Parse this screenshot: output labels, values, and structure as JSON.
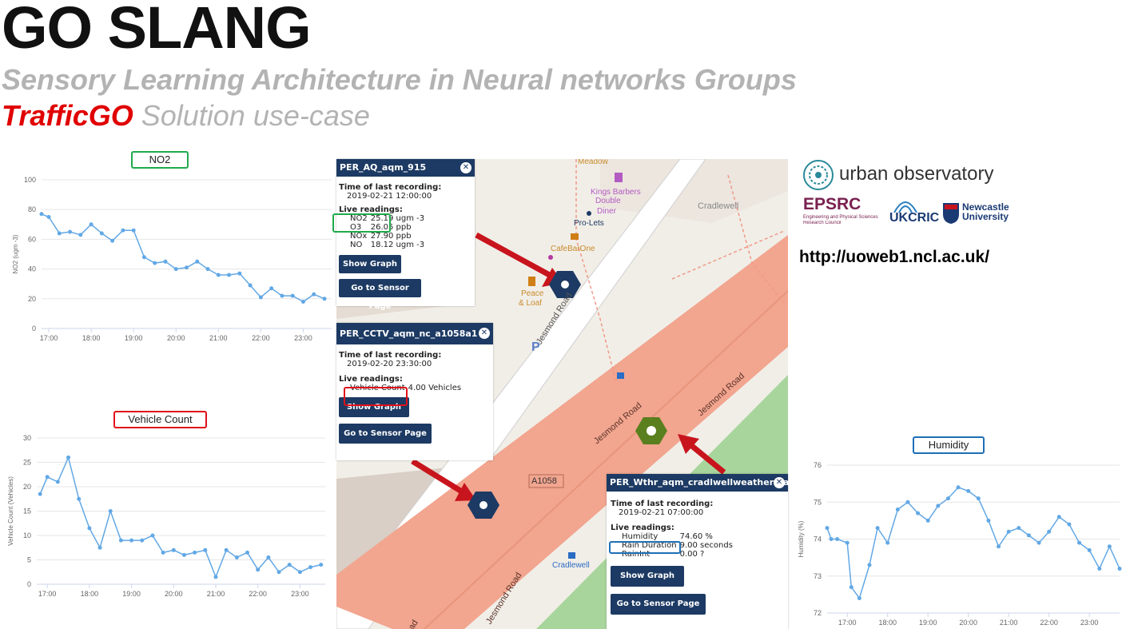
{
  "header": {
    "title": "GO SLANG",
    "subtitle": "Sensory Learning Architecture in Neural networks Groups",
    "usecase_brand": "TrafficGO",
    "usecase_rest": " Solution use-case"
  },
  "colors": {
    "brand_red": "#e00000",
    "no2_box": "#1faa4c",
    "vehicle_box": "#e0101a",
    "humidity_box": "#1e6fb5",
    "line": "#62a8e5",
    "popup_header": "#1c3a63",
    "road": "#f2a58f"
  },
  "charts": {
    "no2": {
      "title": "NO2",
      "ylabel": "NO2 (ugm -3)"
    },
    "vehicle": {
      "title": "Vehicle Count",
      "ylabel": "Vehicle Count (Vehicles)"
    },
    "humidity": {
      "title": "Humidity",
      "ylabel": "Humidity (%)"
    }
  },
  "chart_data": [
    {
      "type": "line",
      "title": "NO2",
      "ylabel": "NO2 (ugm -3)",
      "yticks": [
        0,
        20,
        40,
        60,
        80,
        100
      ],
      "ylim": [
        0,
        100
      ],
      "xticks": [
        "17:00",
        "18:00",
        "19:00",
        "20:00",
        "21:00",
        "22:00",
        "23:00"
      ],
      "xlim": [
        16.83,
        23.67
      ],
      "x": [
        16.83,
        17,
        17.25,
        17.5,
        17.75,
        18,
        18.25,
        18.5,
        18.75,
        19,
        19.25,
        19.5,
        19.75,
        20,
        20.25,
        20.5,
        20.75,
        21,
        21.25,
        21.5,
        21.75,
        22,
        22.25,
        22.5,
        22.75,
        23,
        23.25,
        23.5
      ],
      "series": [
        {
          "values": [
            77,
            75,
            64,
            65,
            63,
            70,
            64,
            59,
            66,
            66,
            48,
            44,
            45,
            40,
            41,
            45,
            40,
            36,
            36,
            37,
            29,
            21,
            27,
            22,
            22,
            18,
            23,
            20
          ]
        }
      ]
    },
    {
      "type": "line",
      "title": "Vehicle Count",
      "ylabel": "Vehicle Count (Vehicles)",
      "yticks": [
        0,
        5,
        10,
        15,
        20,
        25,
        30
      ],
      "ylim": [
        0,
        30
      ],
      "xticks": [
        "17:00",
        "18:00",
        "19:00",
        "20:00",
        "21:00",
        "22:00",
        "23:00"
      ],
      "xlim": [
        16.75,
        23.6
      ],
      "x": [
        16.83,
        17,
        17.25,
        17.5,
        17.75,
        18,
        18.25,
        18.5,
        18.75,
        19,
        19.25,
        19.5,
        19.75,
        20,
        20.25,
        20.5,
        20.75,
        21,
        21.25,
        21.5,
        21.75,
        22,
        22.25,
        22.5,
        22.75,
        23,
        23.25,
        23.5
      ],
      "series": [
        {
          "values": [
            18.5,
            22,
            21,
            26,
            17.5,
            11.5,
            7.5,
            15,
            9,
            9,
            9,
            10,
            6.5,
            7,
            6,
            6.5,
            7,
            1.5,
            7,
            5.5,
            6.5,
            3,
            5.5,
            2.5,
            4,
            2.5,
            3.5,
            4
          ]
        }
      ]
    },
    {
      "type": "line",
      "title": "Humidity",
      "ylabel": "Humidity (%)",
      "yticks": [
        72,
        73,
        74,
        75,
        76
      ],
      "ylim": [
        72,
        76
      ],
      "xticks": [
        "17:00",
        "18:00",
        "19:00",
        "20:00",
        "21:00",
        "22:00",
        "23:00"
      ],
      "xlim": [
        16.5,
        23.75
      ],
      "x": [
        16.5,
        16.6,
        16.75,
        17,
        17.1,
        17.3,
        17.55,
        17.75,
        18,
        18.25,
        18.5,
        18.75,
        19,
        19.25,
        19.5,
        19.75,
        20,
        20.25,
        20.5,
        20.75,
        21,
        21.25,
        21.5,
        21.75,
        22,
        22.25,
        22.5,
        22.75,
        23,
        23.25,
        23.5,
        23.75
      ],
      "series": [
        {
          "values": [
            74.3,
            74,
            74,
            73.9,
            72.7,
            72.4,
            73.3,
            74.3,
            73.9,
            74.8,
            75,
            74.7,
            74.5,
            74.9,
            75.1,
            75.4,
            75.3,
            75.1,
            74.5,
            73.8,
            74.2,
            74.3,
            74.1,
            73.9,
            74.2,
            74.6,
            74.4,
            73.9,
            73.7,
            73.2,
            73.8,
            73.2
          ]
        }
      ]
    }
  ],
  "map": {
    "places": {
      "meadow": "Meadow",
      "kings_barbers": "Kings Barbers",
      "double_diner_1": "Double",
      "double_diner_2": "Diner",
      "pro_lets": "Pro-Lets",
      "cafebarone": "CafeBarOne",
      "peace_1": "Peace",
      "peace_2": "& Loaf",
      "cradlewell_area": "Cradlewell",
      "cradlewell_stop": "Cradlewell"
    },
    "roads": {
      "jesmond_1": "Jesmond Road",
      "jesmond_2": "Jesmond Road",
      "jesmond_3": "Jesmond Road",
      "jesmond_4": "Jesmond Road",
      "jesmond_5": "ad",
      "a1058": "A1058"
    }
  },
  "popups": {
    "aq": {
      "title": "PER_AQ_aqm_915",
      "time_label": "Time of last recording:",
      "time_value": "2019-02-21 12:00:00",
      "live_label": "Live readings:",
      "readings": [
        {
          "name": "NO2",
          "value": "25.19 ugm -3"
        },
        {
          "name": "O3",
          "value": "26.05 ppb"
        },
        {
          "name": "NOx",
          "value": "27.90 ppb"
        },
        {
          "name": "NO",
          "value": "18.12 ugm -3"
        }
      ],
      "show_graph": "Show Graph",
      "sensor_page": "Go to Sensor Page"
    },
    "cctv": {
      "title": "PER_CCTV_aqm_nc_a1058a1",
      "time_label": "Time of last recording:",
      "time_value": "2019-02-20 23:30:00",
      "live_label": "Live readings:",
      "readings": [
        {
          "name": "Vehicle Count",
          "value": "4.00 Vehicles"
        }
      ],
      "show_graph": "Show Graph",
      "sensor_page": "Go to Sensor Page"
    },
    "wthr": {
      "title": "PER_Wthr_aqm_cradlwellweatherstat",
      "time_label": "Time of last recording:",
      "time_value": "2019-02-21 07:00:00",
      "live_label": "Live readings:",
      "readings": [
        {
          "name": "Humidity",
          "value": "74.60 %"
        },
        {
          "name": "Rain Duration",
          "value": "9.00 seconds"
        },
        {
          "name": "RainInt",
          "value": "0.00 ?"
        }
      ],
      "show_graph": "Show Graph",
      "sensor_page": "Go to Sensor Page"
    }
  },
  "logos": {
    "urban_observatory": "urban observatory",
    "epsrc": "EPSRC",
    "epsrc_sub1": "Engineering and Physical Sciences",
    "epsrc_sub2": "Research Council",
    "ukcric": "UKCRIC",
    "newcastle_1": "Newcastle",
    "newcastle_2": "University"
  },
  "url": "http://uoweb1.ncl.ac.uk/"
}
